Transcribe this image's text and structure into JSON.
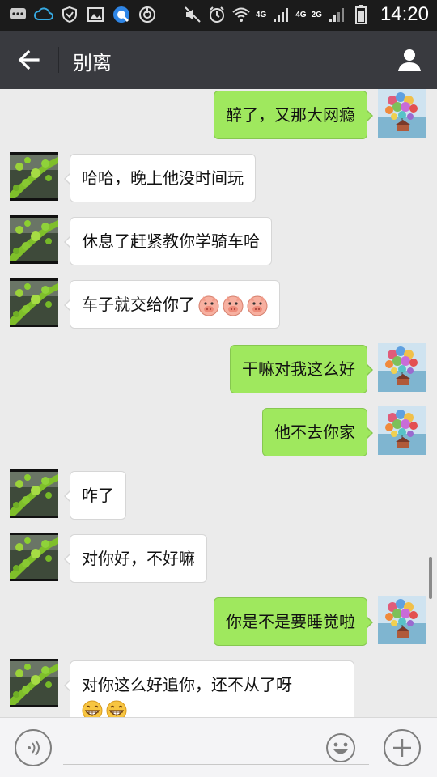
{
  "status_bar": {
    "time": "14:20",
    "network_1": "4G",
    "network_2": "4G",
    "network_3": "2G",
    "icons": [
      "chat-notification-icon",
      "cloud-icon",
      "shield-icon",
      "gallery-icon",
      "browser-icon",
      "power-icon",
      "mute-icon",
      "alarm-icon",
      "wifi-icon",
      "signal-icon",
      "battery-icon"
    ]
  },
  "header": {
    "title": "别离",
    "back_icon": "back-arrow-icon",
    "profile_icon": "person-icon"
  },
  "messages": [
    {
      "side": "out",
      "text": "醉了，又那大网瘾"
    },
    {
      "side": "in",
      "text": "哈哈，晚上他没时间玩"
    },
    {
      "side": "in",
      "text": "休息了赶紧教你学骑车哈"
    },
    {
      "side": "in",
      "text": "车子就交给你了",
      "emojis": [
        "pig-face-emoji",
        "pig-face-emoji",
        "pig-face-emoji"
      ]
    },
    {
      "side": "out",
      "text": "干嘛对我这么好"
    },
    {
      "side": "out",
      "text": "他不去你家"
    },
    {
      "side": "in",
      "text": "咋了"
    },
    {
      "side": "in",
      "text": "对你好，不好嘛"
    },
    {
      "side": "out",
      "text": "你是不是要睡觉啦"
    },
    {
      "side": "in",
      "text": "对你这么好追你，还不从了呀",
      "emojis": [
        "grinning-emoji",
        "grinning-emoji"
      ]
    }
  ],
  "input_bar": {
    "voice_icon": "voice-icon",
    "input_value": "",
    "emoji_icon": "smiley-icon",
    "plus_icon": "plus-icon"
  },
  "colors": {
    "title_bar": "#393a3f",
    "status_bar": "#1b1b1b",
    "chat_background": "#ebebeb",
    "outgoing_bubble": "#9fe85e",
    "incoming_bubble": "#ffffff"
  }
}
